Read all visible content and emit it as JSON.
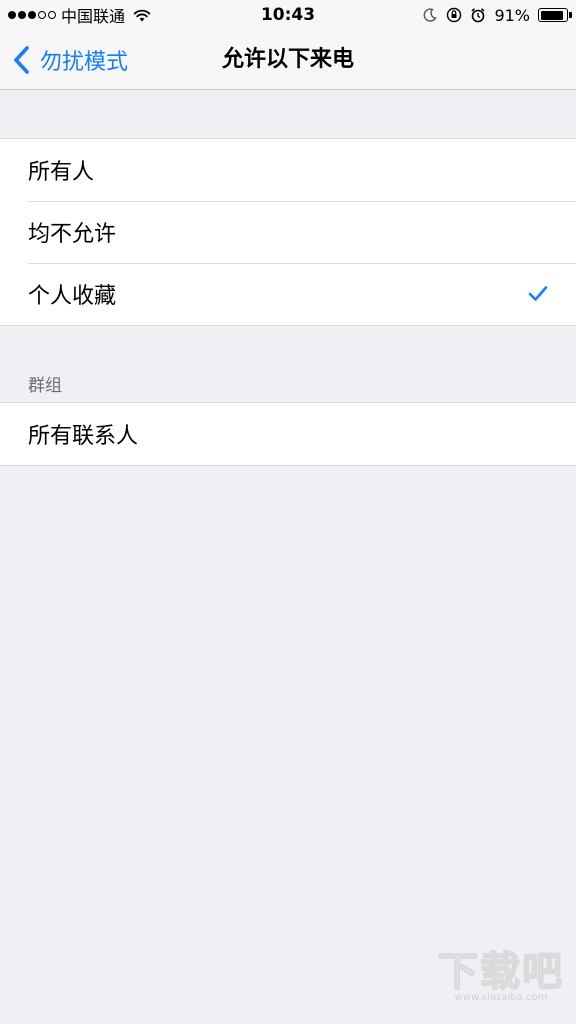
{
  "status_bar": {
    "signal_full": 3,
    "signal_total": 5,
    "carrier": "中国联通",
    "time": "10:43",
    "battery_percent_text": "91%",
    "battery_level": 0.91,
    "icons": [
      "wifi-icon",
      "moon-icon",
      "orientation-lock-icon",
      "alarm-icon",
      "battery-icon"
    ]
  },
  "nav": {
    "back_label": "勿扰模式",
    "title": "允许以下来电"
  },
  "options": [
    {
      "label": "所有人",
      "selected": false
    },
    {
      "label": "均不允许",
      "selected": false
    },
    {
      "label": "个人收藏",
      "selected": true
    }
  ],
  "groups_section": {
    "header": "群组",
    "items": [
      {
        "label": "所有联系人"
      }
    ]
  },
  "watermark": {
    "text": "下载吧",
    "url": "www.xiazaiba.com"
  },
  "colors": {
    "accent": "#157efb",
    "background": "#efeff4",
    "bar_background": "#f7f7f7",
    "separator": "#dcdce0",
    "section_header": "#6d6d72"
  }
}
